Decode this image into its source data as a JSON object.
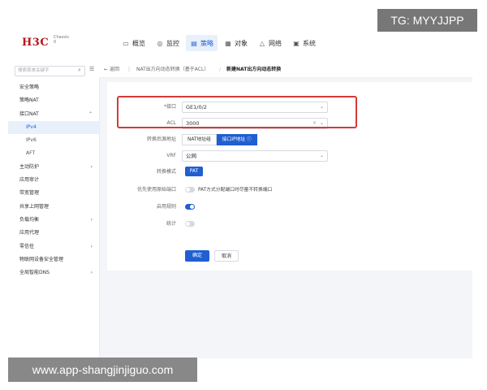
{
  "watermarks": {
    "top": "TG: MYYJJPP",
    "bottom": "www.app-shangjinjiguo.com"
  },
  "brand": {
    "logo": "H3C",
    "sub1": "Chassis",
    "sub2": "0"
  },
  "nav": [
    {
      "label": "概览",
      "icon": "monitor-icon"
    },
    {
      "label": "监控",
      "icon": "location-icon"
    },
    {
      "label": "策略",
      "icon": "clipboard-icon",
      "active": true
    },
    {
      "label": "对象",
      "icon": "grid-icon"
    },
    {
      "label": "网络",
      "icon": "network-icon"
    },
    {
      "label": "系统",
      "icon": "system-icon"
    }
  ],
  "sidebar": {
    "search_placeholder": "搜索菜单关键字",
    "items": [
      {
        "label": "安全策略"
      },
      {
        "label": "策略NAT"
      },
      {
        "label": "接口NAT"
      },
      {
        "label": "IPv4"
      },
      {
        "label": "IPv6"
      },
      {
        "label": "AFT"
      },
      {
        "label": "主动防护"
      },
      {
        "label": "应用审计"
      },
      {
        "label": "带宽管理"
      },
      {
        "label": "共享上网管理"
      },
      {
        "label": "负载均衡"
      },
      {
        "label": "应用代理"
      },
      {
        "label": "零信任"
      },
      {
        "label": "物联网设备安全管理"
      },
      {
        "label": "全局智能DNS"
      }
    ]
  },
  "breadcrumb": {
    "back": "返回",
    "parent": "NAT出方向动态转换（基于ACL）",
    "current": "新建NAT出方向动态转换"
  },
  "form": {
    "interface_label": "*接口",
    "interface_value": "GE1/0/2",
    "acl_label": "ACL",
    "acl_value": "3000",
    "translated_label": "转换后源地址",
    "translated_options": [
      "NAT地址组",
      "接口IP地址 ⓘ"
    ],
    "vrf_label": "VRF",
    "vrf_value": "公网",
    "mode_label": "转换模式",
    "mode_value": "PAT",
    "priority_label": "优先使用原始端口",
    "priority_text": "PAT方式分配端口时尽量不转换端口",
    "enable_label": "启用规则",
    "stats_label": "统计",
    "ok": "确定",
    "cancel": "取消"
  },
  "colors": {
    "accent": "#1f5fd1",
    "highlight": "#d23a3a",
    "brand": "#b5161e"
  }
}
